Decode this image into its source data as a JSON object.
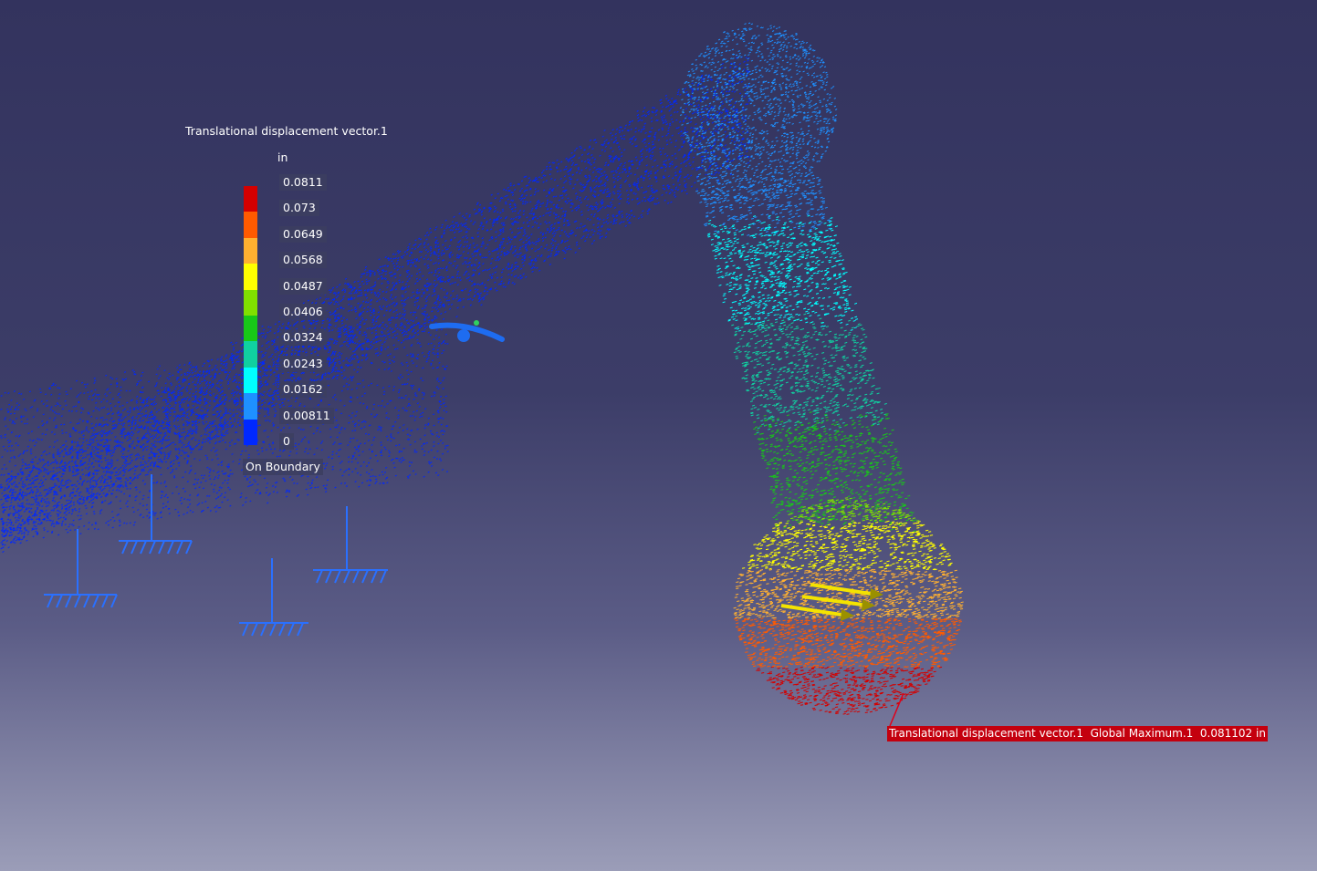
{
  "legend": {
    "title": "Translational displacement vector.1",
    "unit": "in",
    "values": [
      "0.0811",
      "0.073",
      "0.0649",
      "0.0568",
      "0.0487",
      "0.0406",
      "0.0324",
      "0.0243",
      "0.0162",
      "0.00811",
      "0"
    ],
    "colors": [
      "#d40000",
      "#ff5a00",
      "#ffb030",
      "#ffff00",
      "#80e000",
      "#18c818",
      "#10d0a0",
      "#00ffff",
      "#1e90ff",
      "#0028ff"
    ],
    "footer": "On Boundary"
  },
  "max_annotation": {
    "text": "Translational displacement vector.1  Global Maximum.1  0.081102 in",
    "color": "#c4000e"
  },
  "icons": [
    "ground-clamp-icon",
    "force-arrow-icon",
    "compass-icon"
  ]
}
